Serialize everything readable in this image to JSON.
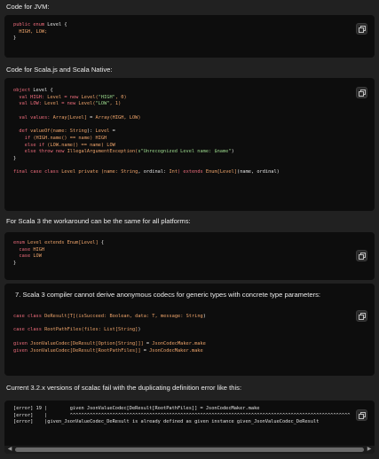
{
  "sections": {
    "jvm_heading": "Code for JVM:",
    "scalajs_heading": "Code for Scala.js and Scala Native:",
    "scala3_heading": "For Scala 3 the workaround can be the same for all platforms:",
    "item7_heading": "7. Scala 3 compiler cannot derive anonymous codecs for generic types with concrete type parameters:",
    "scalac_heading": "Current 3.2.x versions of scalac fail with the duplicating definition error like this:"
  },
  "code_blocks": {
    "jvm": {
      "l1a": "public enum ",
      "l1b": "Level {",
      "l2": "  HIGH, LOW;",
      "l3": "}"
    },
    "scalajs": {
      "l1a": "object ",
      "l1b": "Level {",
      "l2a": "  val HIGH: ",
      "l2b": "Level",
      "l2c": " = new ",
      "l2d": "Level(",
      "l2e": "\"HIGH\"",
      "l2f": ", ",
      "l2g": "0",
      "l2h": ")",
      "l3a": "  val LOW: ",
      "l3b": "Level",
      "l3c": " = new ",
      "l3d": "Level(",
      "l3e": "\"LOW\"",
      "l3f": ", ",
      "l3g": "1",
      "l3h": ")",
      "l4a": "  val values: ",
      "l4b": "Array[Level]",
      "l4c": " = ",
      "l4d": "Array(HIGH, LOW)",
      "l5a": "  def ",
      "l5b": "valueOf(name: ",
      "l5c": "String",
      "l5d": "): ",
      "l5e": "Level",
      "l5f": " =",
      "l6a": "    if ",
      "l6b": "(HIGH.name() == name) HIGH",
      "l7a": "    else if ",
      "l7b": "(LOW.name() == name) LOW",
      "l8a": "    else throw new ",
      "l8b": "IllegalArgumentException(",
      "l8c": "s\"Unrecognized Level name: $name\"",
      "l8d": ")",
      "l9": "}",
      "l10a": "final case class ",
      "l10b": "Level private (name: ",
      "l10c": "String",
      "l10d": ", ordinal: ",
      "l10e": "Int",
      "l10f": ") extends ",
      "l10g": "Enum[Level]",
      "l10h": "(name, ordinal)"
    },
    "scala3": {
      "l1a": "enum ",
      "l1b": "Level extends ",
      "l1c": "Enum[Level]",
      "l1d": " {",
      "l2a": "  case ",
      "l2b": "HIGH",
      "l3a": "  case ",
      "l3b": "LOW",
      "l4": "}"
    },
    "item7": {
      "l1a": "case class ",
      "l1b": "DeResult[T](isSucceed: ",
      "l1c": "Boolean",
      "l1d": ", data: ",
      "l1e": "T",
      "l1f": ", message: ",
      "l1g": "String",
      "l1h": ")",
      "l2a": "case class ",
      "l2b": "RootPathFiles(files: ",
      "l2c": "List[String]",
      "l2d": ")",
      "l3a": "given ",
      "l3b": "JsonValueCodec[DeResult[Option[String]]]",
      "l3c": " = ",
      "l3d": "JsonCodecMaker.make",
      "l4a": "given ",
      "l4b": "JsonValueCodec[DeResult[RootPathFiles]]",
      "l4c": " = ",
      "l4d": "JsonCodecMaker.make"
    },
    "scalac": {
      "l1": "[error] 19 |        given JsonValueCodec[DeResult[RootPathFiles]] = JsonCodecMaker.make",
      "l2": "[error]    |        ^^^^^^^^^^^^^^^^^^^^^^^^^^^^^^^^^^^^^^^^^^^^^^^^^^^^^^^^^^^^^^^^^^^^^^^^^^^^^^^^^^^^^^^^^^^^^^^^^^^",
      "l3": "[error]    |given_JsonValueCodec_DeResult is already defined as given instance given_JsonValueCodec_DeResult"
    }
  },
  "icons": {
    "copy": "copy-icon",
    "scroll_left": "triangle-left-icon",
    "scroll_right": "triangle-right-icon"
  },
  "scroll_arrows": {
    "left": "◀",
    "right": "▶"
  }
}
